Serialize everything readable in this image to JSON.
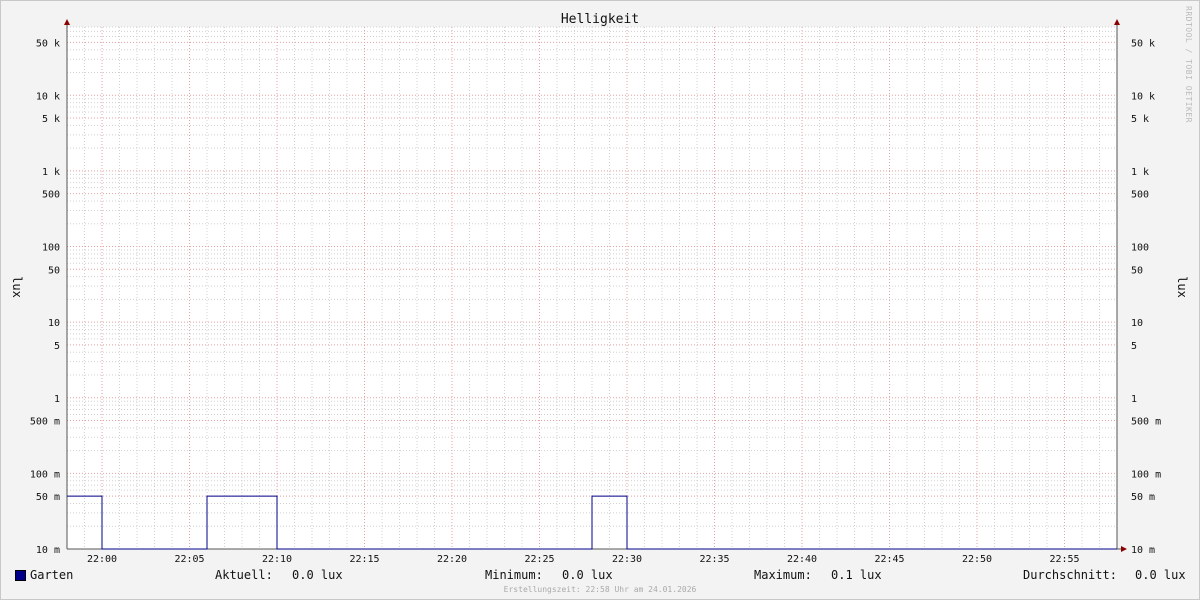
{
  "colors": {
    "series": "#00008b",
    "major_grid": "#e8a0a0",
    "minor_grid": "#d0d0d0",
    "axis": "#555555",
    "arrow": "#8b0000"
  },
  "watermark": "RRDTOOL / TOBI OETIKER",
  "chart_data": {
    "type": "line",
    "title": "Helligkeit",
    "ylabel": "lux",
    "ylabel_right": "lux",
    "y_scale": "log",
    "ylim": [
      0.01,
      80000
    ],
    "xlim": [
      "21:58",
      "22:58"
    ],
    "y_ticks": [
      {
        "v": 50000,
        "label": "50 k"
      },
      {
        "v": 10000,
        "label": "10 k"
      },
      {
        "v": 5000,
        "label": "5 k"
      },
      {
        "v": 1000,
        "label": "1 k"
      },
      {
        "v": 500,
        "label": "500"
      },
      {
        "v": 100,
        "label": "100"
      },
      {
        "v": 50,
        "label": "50"
      },
      {
        "v": 10,
        "label": "10"
      },
      {
        "v": 5,
        "label": "5"
      },
      {
        "v": 1,
        "label": "1"
      },
      {
        "v": 0.5,
        "label": "500 m"
      },
      {
        "v": 0.1,
        "label": "100 m"
      },
      {
        "v": 0.05,
        "label": "50 m"
      },
      {
        "v": 0.01,
        "label": "10 m"
      }
    ],
    "x_ticks": [
      "22:00",
      "22:05",
      "22:10",
      "22:15",
      "22:20",
      "22:25",
      "22:30",
      "22:35",
      "22:40",
      "22:45",
      "22:50",
      "22:55"
    ],
    "series": [
      {
        "name": "Garten",
        "steps": [
          {
            "x": "21:58",
            "y": 0.05
          },
          {
            "x": "22:00",
            "y": 0.01
          },
          {
            "x": "22:06",
            "y": 0.05
          },
          {
            "x": "22:10",
            "y": 0.01
          },
          {
            "x": "22:28",
            "y": 0.05
          },
          {
            "x": "22:30",
            "y": 0.01
          },
          {
            "x": "22:58",
            "y": 0.01
          }
        ]
      }
    ]
  },
  "legend": {
    "series_name": "Garten",
    "current_label": "Aktuell:",
    "current_value": "0.0 lux",
    "min_label": "Minimum:",
    "min_value": "0.0 lux",
    "max_label": "Maximum:",
    "max_value": "0.1 lux",
    "avg_label": "Durchschnitt:",
    "avg_value": "0.0 lux"
  },
  "footer": "Erstellungszeit: 22:58 Uhr am 24.01.2026"
}
